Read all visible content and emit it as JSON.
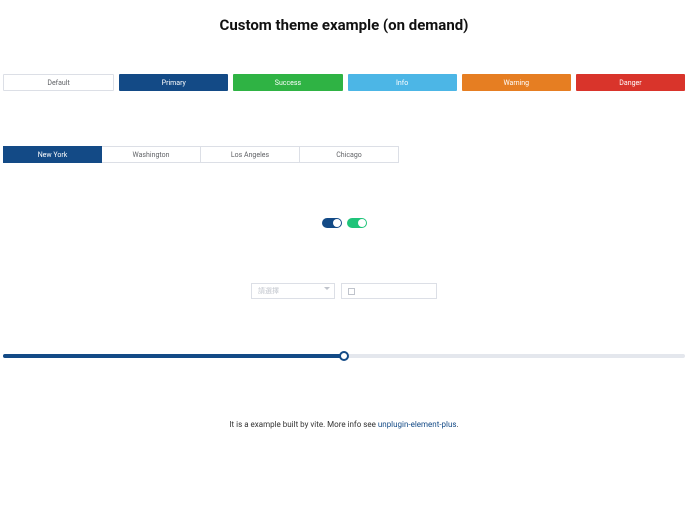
{
  "title": "Custom theme example (on demand)",
  "buttons": {
    "default": "Default",
    "primary": "Primary",
    "success": "Success",
    "info": "Info",
    "warning": "Warning",
    "danger": "Danger"
  },
  "tabs": {
    "items": [
      "New York",
      "Washington",
      "Los Angeles",
      "Chicago"
    ],
    "active_index": 0
  },
  "switches": {
    "left_on": true,
    "right_on": true
  },
  "select": {
    "placeholder": "請選擇"
  },
  "slider": {
    "value": 50,
    "min": 0,
    "max": 100
  },
  "footer": {
    "text_prefix": "It is a example built by vite.  More info see ",
    "link_text": "unplugin-element-plus",
    "text_suffix": "."
  },
  "colors": {
    "primary": "#134a86",
    "success": "#2fb344",
    "info": "#4cb6e6",
    "warning": "#e67e22",
    "danger": "#d9342b"
  }
}
